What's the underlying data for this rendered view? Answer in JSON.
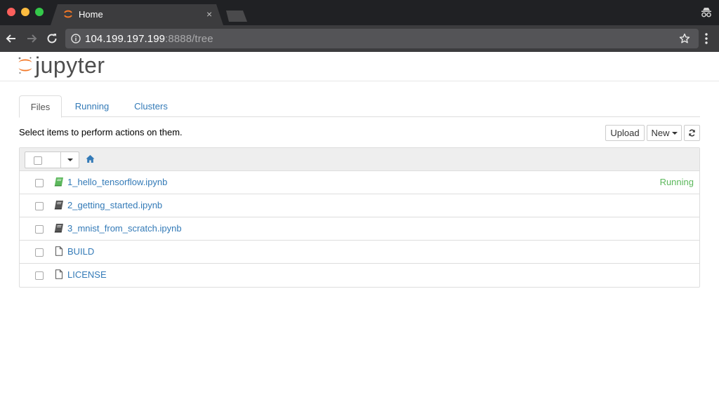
{
  "browser": {
    "tab_title": "Home",
    "tab_close": "×",
    "url_host": "104.199.197.199",
    "url_rest": ":8888/tree"
  },
  "header": {
    "logo_text": "jupyter",
    "logo_color": "#f37726"
  },
  "tabs": [
    {
      "label": "Files",
      "active": true
    },
    {
      "label": "Running",
      "active": false
    },
    {
      "label": "Clusters",
      "active": false
    }
  ],
  "toolbar": {
    "hint": "Select items to perform actions on them.",
    "upload_label": "Upload",
    "new_label": "New"
  },
  "files": [
    {
      "name": "1_hello_tensorflow.ipynb",
      "icon": "notebook-icon",
      "status": "Running",
      "icon_color": "#5cb85c"
    },
    {
      "name": "2_getting_started.ipynb",
      "icon": "notebook-icon",
      "status": "",
      "icon_color": "#555555"
    },
    {
      "name": "3_mnist_from_scratch.ipynb",
      "icon": "notebook-icon",
      "status": "",
      "icon_color": "#555555"
    },
    {
      "name": "BUILD",
      "icon": "file-icon",
      "status": ""
    },
    {
      "name": "LICENSE",
      "icon": "file-icon",
      "status": ""
    }
  ],
  "colors": {
    "link": "#337ab7",
    "running": "#5cb85c"
  }
}
